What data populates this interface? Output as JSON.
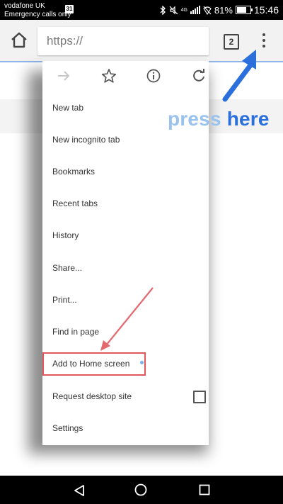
{
  "status_bar": {
    "carrier": "vodafone UK",
    "carrier_sub": "Emergency calls only",
    "date_badge": "31",
    "network": "4G",
    "battery_percent": "81%",
    "battery_level": 0.81,
    "time": "15:46"
  },
  "toolbar": {
    "url_placeholder": "https://",
    "tab_count": "2"
  },
  "menu": {
    "top_icons": [
      "forward-icon",
      "star-icon",
      "info-icon",
      "reload-icon"
    ],
    "items": [
      {
        "label": "New tab"
      },
      {
        "label": "New incognito tab"
      },
      {
        "label": "Bookmarks"
      },
      {
        "label": "Recent tabs"
      },
      {
        "label": "History"
      },
      {
        "label": "Share..."
      },
      {
        "label": "Print..."
      },
      {
        "label": "Find in page"
      },
      {
        "label": "Add to Home screen"
      },
      {
        "label": "Request desktop site"
      },
      {
        "label": "Settings"
      }
    ],
    "request_desktop_checked": false
  },
  "annotation": {
    "press_text_1": "press",
    "press_text_2": "here",
    "arrow_color": "#2a6fdb",
    "highlight_color": "#e0585e"
  },
  "nav_bar": {
    "icons": [
      "back-triangle-icon",
      "home-circle-icon",
      "recents-square-icon"
    ]
  }
}
